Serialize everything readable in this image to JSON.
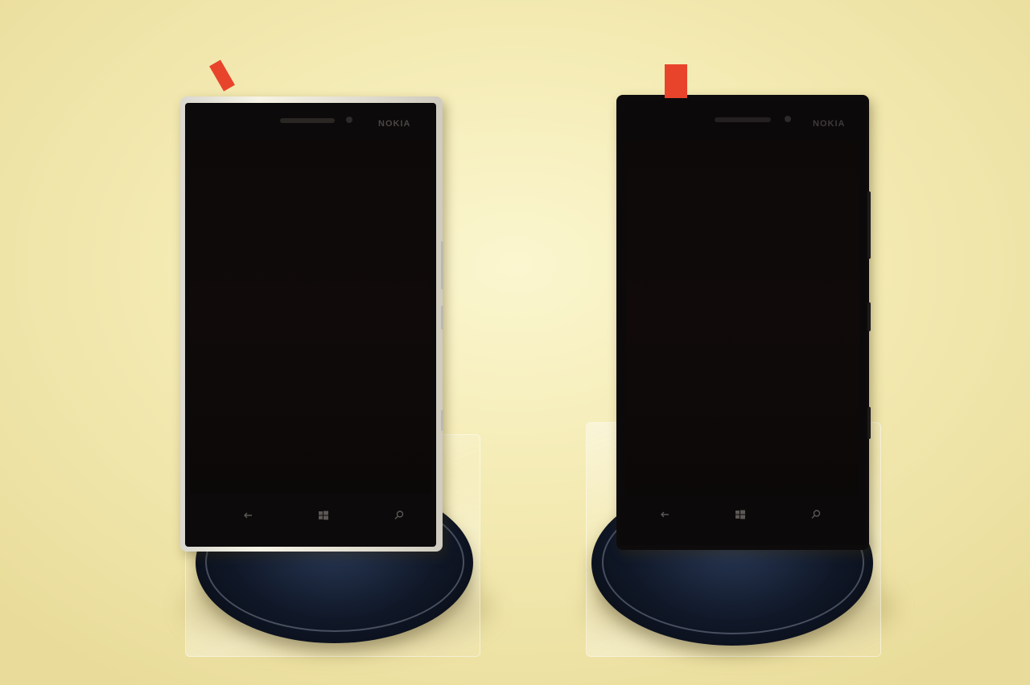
{
  "scene": {
    "background": "#f4ebb4",
    "accent_tag_color": "#e8442c"
  },
  "phones": [
    {
      "finish": "silver",
      "brand": "NOKIA",
      "nav_icons": [
        "back-arrow-icon",
        "windows-logo-icon",
        "search-icon"
      ]
    },
    {
      "finish": "black",
      "brand": "NOKIA",
      "nav_icons": [
        "back-arrow-icon",
        "windows-logo-icon",
        "search-icon"
      ]
    }
  ]
}
